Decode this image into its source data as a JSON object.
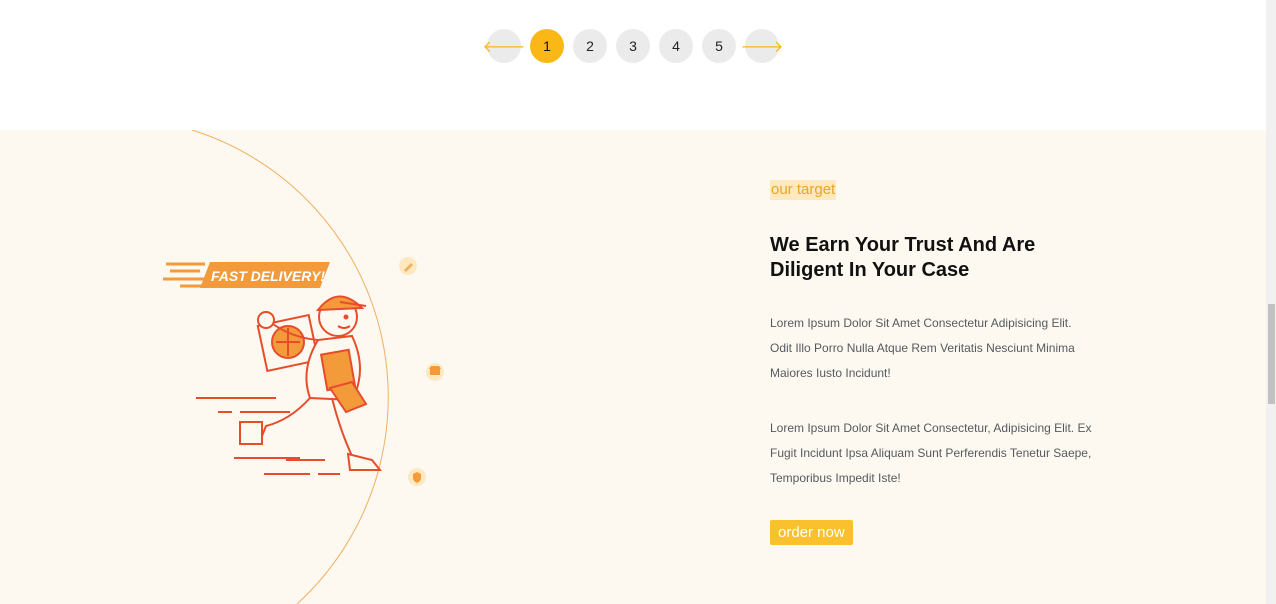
{
  "pagination": {
    "prev_icon": "arrow-left-icon",
    "next_icon": "arrow-right-icon",
    "prev_glyph": "🡐",
    "next_glyph": "🡒",
    "pages": [
      "1",
      "2",
      "3",
      "4",
      "5"
    ],
    "active_page": "1"
  },
  "illustration": {
    "banner_text": "FAST DELIVERY!",
    "icons": [
      "pencil-icon",
      "shop-icon",
      "shield-icon"
    ]
  },
  "target_section": {
    "tag": "our target",
    "heading": "We Earn Your Trust And Are Diligent In Your Case",
    "paragraph_1": "Lorem Ipsum Dolor Sit Amet Consectetur Adipisicing Elit. Odit Illo Porro Nulla Atque Rem Veritatis Nesciunt Minima Maiores Iusto Incidunt!",
    "paragraph_2": "Lorem Ipsum Dolor Sit Amet Consectetur, Adipisicing Elit. Ex Fugit Incidunt Ipsa Aliquam Sunt Perferendis Tenetur Saepe, Temporibus Impedit Iste!",
    "button_label": "order now"
  },
  "colors": {
    "accent": "#f9b816",
    "section_bg": "#fdf9f0",
    "tag_bg": "#fde8bf",
    "illustration_red": "#e74c2b",
    "illustration_orange": "#f39a3a"
  }
}
